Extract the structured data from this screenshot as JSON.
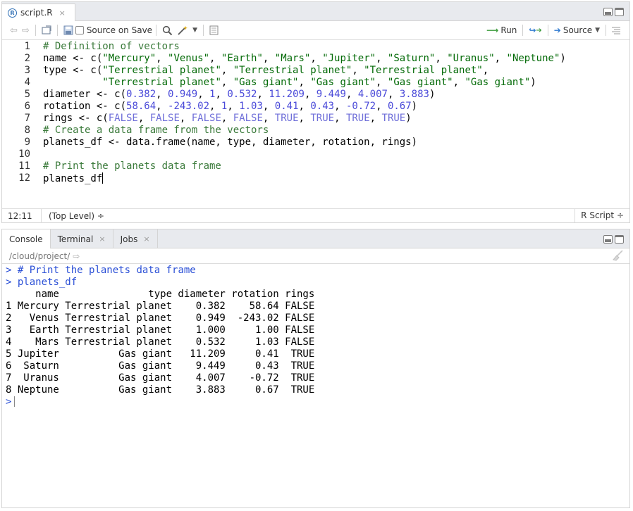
{
  "editor": {
    "file_tab": {
      "badge": "R",
      "name": "script.R",
      "close": "×"
    },
    "toolbar": {
      "source_on_save": "Source on Save",
      "run": "Run",
      "source": "Source"
    },
    "lines": [
      {
        "no": "1",
        "text": "# Definition of vectors",
        "kind": "comment"
      },
      {
        "no": "2",
        "text": "name <- c(\"Mercury\", \"Venus\", \"Earth\", \"Mars\", \"Jupiter\", \"Saturn\", \"Uranus\", \"Neptune\")",
        "kind": "code"
      },
      {
        "no": "3",
        "text": "type <- c(\"Terrestrial planet\", \"Terrestrial planet\", \"Terrestrial planet\",",
        "kind": "code"
      },
      {
        "no": "4",
        "text": "          \"Terrestrial planet\", \"Gas giant\", \"Gas giant\", \"Gas giant\", \"Gas giant\")",
        "kind": "code"
      },
      {
        "no": "5",
        "text": "diameter <- c(0.382, 0.949, 1, 0.532, 11.209, 9.449, 4.007, 3.883)",
        "kind": "code"
      },
      {
        "no": "6",
        "text": "rotation <- c(58.64, -243.02, 1, 1.03, 0.41, 0.43, -0.72, 0.67)",
        "kind": "code"
      },
      {
        "no": "7",
        "text": "rings <- c(FALSE, FALSE, FALSE, FALSE, TRUE, TRUE, TRUE, TRUE)",
        "kind": "code"
      },
      {
        "no": "8",
        "text": "# Create a data frame from the vectors",
        "kind": "comment"
      },
      {
        "no": "9",
        "text": "planets_df <- data.frame(name, type, diameter, rotation, rings)",
        "kind": "code"
      },
      {
        "no": "10",
        "text": "",
        "kind": "code"
      },
      {
        "no": "11",
        "text": "# Print the planets data frame",
        "kind": "comment"
      },
      {
        "no": "12",
        "text": "planets_df",
        "kind": "code"
      }
    ],
    "status": {
      "position": "12:11",
      "scope": "(Top Level) ÷",
      "filetype": "R Script ÷"
    }
  },
  "console": {
    "tabs": [
      {
        "label": "Console",
        "closable": false
      },
      {
        "label": "Terminal",
        "closable": true
      },
      {
        "label": "Jobs",
        "closable": true
      }
    ],
    "path": "/cloud/project/",
    "lines": [
      {
        "text": "> # Print the planets data frame",
        "kind": "input"
      },
      {
        "text": "> planets_df",
        "kind": "input"
      },
      {
        "text": "     name               type diameter rotation rings",
        "kind": "output"
      },
      {
        "text": "1 Mercury Terrestrial planet    0.382    58.64 FALSE",
        "kind": "output"
      },
      {
        "text": "2   Venus Terrestrial planet    0.949  -243.02 FALSE",
        "kind": "output"
      },
      {
        "text": "3   Earth Terrestrial planet    1.000     1.00 FALSE",
        "kind": "output"
      },
      {
        "text": "4    Mars Terrestrial planet    0.532     1.03 FALSE",
        "kind": "output"
      },
      {
        "text": "5 Jupiter          Gas giant   11.209     0.41  TRUE",
        "kind": "output"
      },
      {
        "text": "6  Saturn          Gas giant    9.449     0.43  TRUE",
        "kind": "output"
      },
      {
        "text": "7  Uranus          Gas giant    4.007    -0.72  TRUE",
        "kind": "output"
      },
      {
        "text": "8 Neptune          Gas giant    3.883     0.67  TRUE",
        "kind": "output"
      },
      {
        "text": ">",
        "kind": "prompt"
      }
    ]
  }
}
